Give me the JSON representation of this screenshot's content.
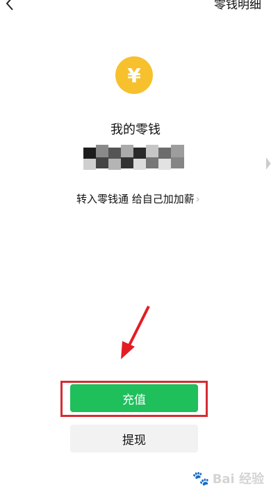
{
  "header": {
    "right_label": "零钱明细"
  },
  "balance": {
    "title": "我的零钱",
    "transfer_text": "转入零钱通 给自己加加薪",
    "transfer_chevron": "›"
  },
  "icons": {
    "back": "chevron-left-icon",
    "coin_symbol": "¥",
    "side": "chevron-right-icon"
  },
  "actions": {
    "recharge_label": "充值",
    "withdraw_label": "提现"
  },
  "watermark": {
    "text": "Bai 经验"
  },
  "colors": {
    "coin": "#f7c12d",
    "primary_button": "#1fbf5c",
    "highlight": "#d62b32",
    "arrow": "#e31d23"
  }
}
